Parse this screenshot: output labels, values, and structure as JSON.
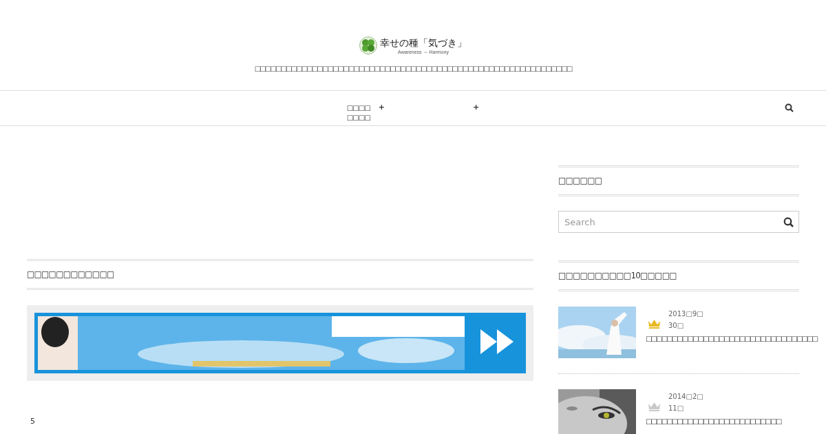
{
  "header": {
    "logo_title": "幸せの種「気づき」",
    "logo_subtitle": "Awareness ～ Harmony",
    "tagline": "□□□□□□□□□□□□□□□□□□□□□□□□□□□□□□□□□□□□□□□□□□□□□□□□□□□□□□□□□□□□□"
  },
  "nav": {
    "items": [
      {
        "label": "□□□□ □□□□",
        "toggle": "+"
      },
      {
        "toggle": "+"
      }
    ]
  },
  "main": {
    "section_title": "□□□□□□□□□□□□",
    "page_number": "5"
  },
  "sidebar": {
    "search_widget": {
      "title": "□□□□□□",
      "placeholder": "Search"
    },
    "popular": {
      "title": "□□□□□□□□□□10□□□□□",
      "posts": [
        {
          "date_line": "2013□9□",
          "day_line": "30□",
          "title": "□□□□□□□□□□□□□□□□□□□□□□□□□□□□□□□□□",
          "color": "#e8b923"
        },
        {
          "date_line": "2014□2□",
          "day_line": "11□",
          "title": "□□□□□□□□□□□□□□□□□□□□□□□□□□",
          "color": "#c8c8c8"
        }
      ]
    }
  }
}
